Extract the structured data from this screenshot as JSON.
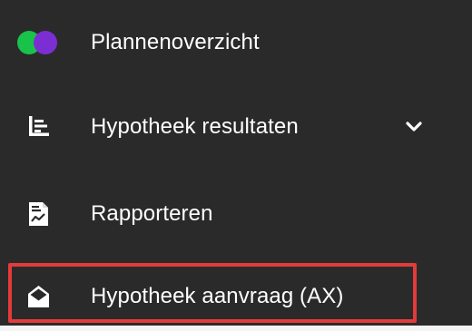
{
  "menu": {
    "items": [
      {
        "id": "plans",
        "label": "Plannenoverzicht",
        "icon": "toggle-circles-icon"
      },
      {
        "id": "results",
        "label": "Hypotheek resultaten",
        "icon": "bar-chart-icon",
        "expandable": true
      },
      {
        "id": "reports",
        "label": "Rapporteren",
        "icon": "document-chart-icon"
      },
      {
        "id": "apply",
        "label": "Hypotheek aanvraag (AX)",
        "icon": "envelope-open-icon",
        "highlighted": true
      }
    ]
  },
  "colors": {
    "panel_background": "#2a2a2a",
    "text": "#ffffff",
    "logo_green": "#19c24a",
    "logo_purple": "#7b2fd3",
    "highlight_border": "#e33b3b"
  }
}
